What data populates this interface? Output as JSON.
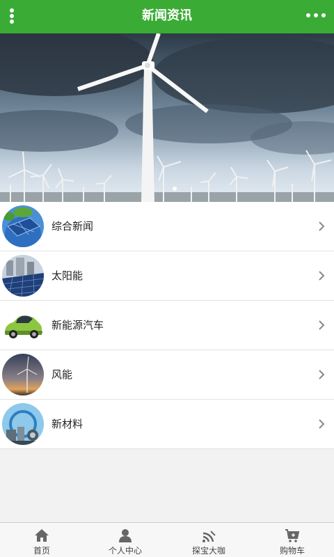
{
  "header": {
    "title": "新闻资讯"
  },
  "categories": [
    {
      "label": "综合新闻",
      "icon": "chevron-right-icon"
    },
    {
      "label": "太阳能",
      "icon": "chevron-right-icon"
    },
    {
      "label": "新能源汽车",
      "icon": "chevron-right-icon"
    },
    {
      "label": "风能",
      "icon": "chevron-right-icon"
    },
    {
      "label": "新材料",
      "icon": "chevron-right-icon"
    }
  ],
  "tabbar": [
    {
      "label": "首页",
      "icon": "home-icon"
    },
    {
      "label": "个人中心",
      "icon": "user-icon"
    },
    {
      "label": "探宝大咖",
      "icon": "signal-icon"
    },
    {
      "label": "购物车",
      "icon": "cart-icon"
    }
  ],
  "colors": {
    "accent": "#3aab34",
    "divider": "#e3e3e3",
    "background": "#f2f2f2"
  }
}
